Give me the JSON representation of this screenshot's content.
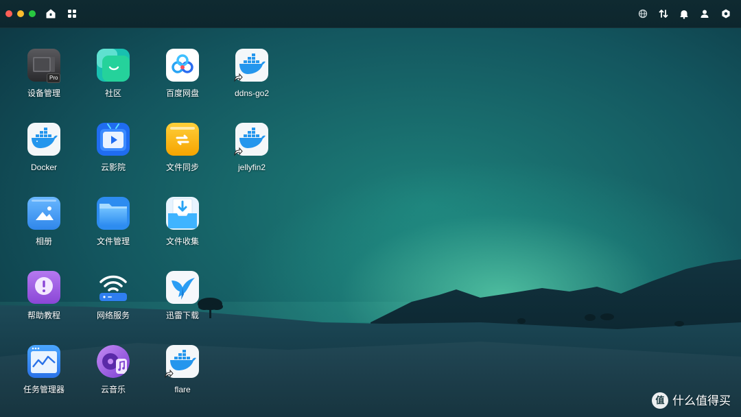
{
  "topbar": {
    "left_icons": [
      "home-icon",
      "apps-grid-icon"
    ],
    "right_icons": [
      "network-icon",
      "transfer-icon",
      "bell-icon",
      "user-icon",
      "settings-icon"
    ]
  },
  "desktop": {
    "apps": [
      {
        "label": "设备管理",
        "icon": "device-manager-icon",
        "badge": "Pro"
      },
      {
        "label": "社区",
        "icon": "community-icon"
      },
      {
        "label": "百度网盘",
        "icon": "baidu-netdisk-icon"
      },
      {
        "label": "ddns-go2",
        "icon": "docker-whale-icon",
        "shortcut": true
      },
      {
        "label": "Docker",
        "icon": "docker-whale-icon"
      },
      {
        "label": "云影院",
        "icon": "cloud-cinema-icon"
      },
      {
        "label": "文件同步",
        "icon": "file-sync-icon"
      },
      {
        "label": "jellyfin2",
        "icon": "docker-whale-icon",
        "shortcut": true
      },
      {
        "label": "相册",
        "icon": "photo-album-icon"
      },
      {
        "label": "文件管理",
        "icon": "folder-icon"
      },
      {
        "label": "文件收集",
        "icon": "file-collect-icon"
      },
      {
        "label": "帮助教程",
        "icon": "help-icon"
      },
      {
        "label": "网络服务",
        "icon": "wifi-router-icon"
      },
      {
        "label": "迅雷下载",
        "icon": "thunder-bird-icon"
      },
      {
        "label": "任务管理器",
        "icon": "task-manager-icon"
      },
      {
        "label": "云音乐",
        "icon": "cloud-music-icon"
      },
      {
        "label": "flare",
        "icon": "docker-whale-icon",
        "shortcut": true
      }
    ]
  },
  "watermark": {
    "logo_text": "值",
    "text": "什么值得买"
  },
  "colors": {
    "close": "#ff5f57",
    "minimize": "#febc2e",
    "maximize": "#28c840",
    "docker_blue": "#2496ed",
    "wallpaper_glow": "#5fe0b0"
  }
}
